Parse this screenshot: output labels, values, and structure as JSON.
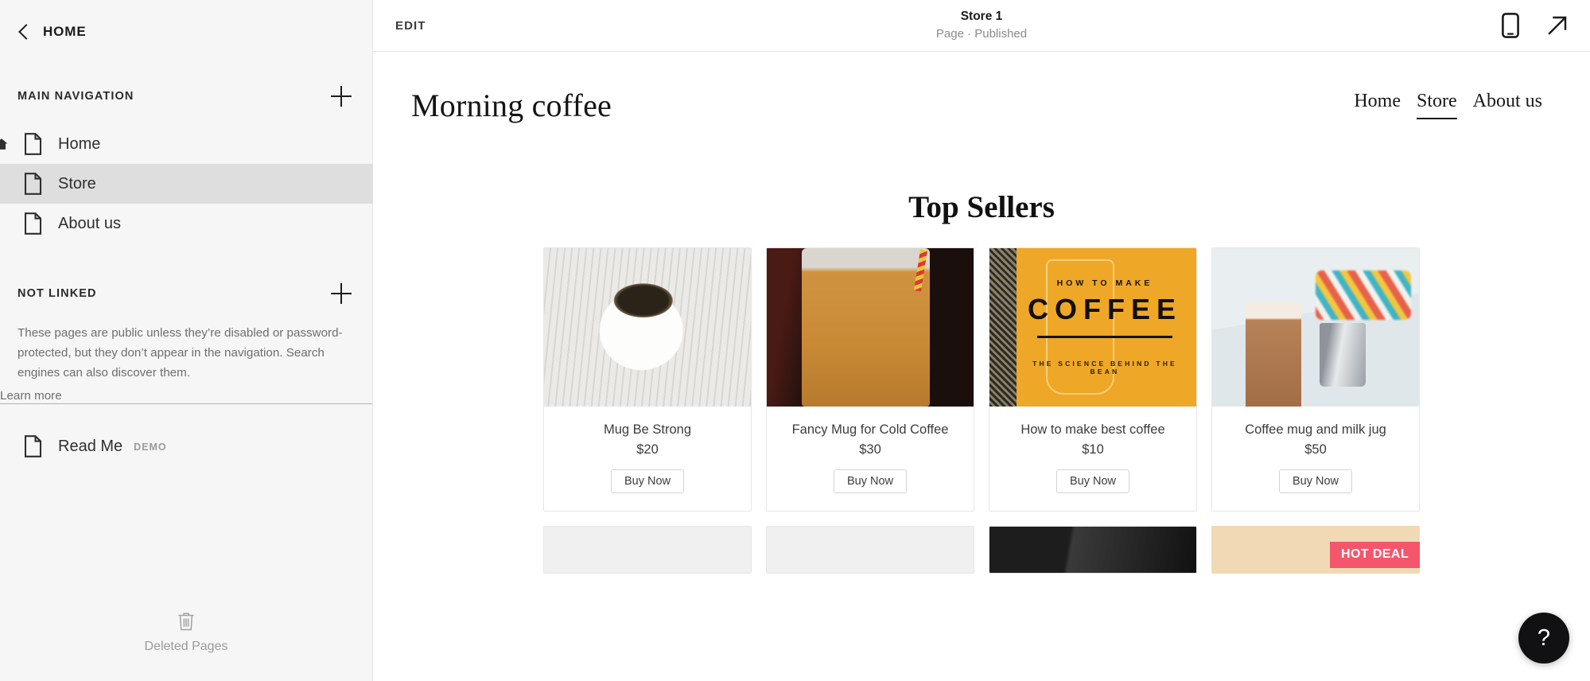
{
  "sidebar": {
    "back_label": "HOME",
    "sections": [
      {
        "title": "MAIN NAVIGATION",
        "add_label": "+"
      },
      {
        "title": "NOT LINKED",
        "add_label": "+"
      }
    ],
    "main_nav_items": [
      {
        "label": "Home",
        "active": false,
        "is_homepage": true
      },
      {
        "label": "Store",
        "active": true,
        "is_homepage": false
      },
      {
        "label": "About us",
        "active": false,
        "is_homepage": false
      }
    ],
    "not_linked_description": "These pages are public unless they’re disabled or password-protected, but they don’t appear in the navigation. Search engines can also discover them.",
    "learn_more_label": "Learn more",
    "not_linked_items": [
      {
        "label": "Read Me",
        "badge": "DEMO"
      }
    ],
    "deleted_pages_label": "Deleted Pages",
    "deleted_pages_icon": "trash-icon",
    "active_row_color": "#dedede",
    "background_color": "#f6f6f6"
  },
  "topbar": {
    "edit_label": "EDIT",
    "page_title": "Store 1",
    "page_status": "Page · Published",
    "icons": [
      {
        "name": "mobile-preview-icon"
      },
      {
        "name": "open-external-arrow-icon"
      }
    ]
  },
  "site": {
    "logo": "Morning coffee",
    "nav": [
      {
        "label": "Home",
        "current": false
      },
      {
        "label": "Store",
        "current": true
      },
      {
        "label": "About us",
        "current": false
      }
    ],
    "section_title": "Top Sellers",
    "buy_label": "Buy Now",
    "products": [
      {
        "name": "Mug Be Strong",
        "price": "$20",
        "image": "img-mugstrong",
        "image_alt": "white mug with BE STRONG text"
      },
      {
        "name": "Fancy Mug for Cold Coffee",
        "price": "$30",
        "image": "img-coldbrew",
        "image_alt": "mason jar of iced coffee with striped straw"
      },
      {
        "name": "How to make best coffee",
        "price": "$10",
        "image": "img-howto",
        "image_alt": "yellow poster How To Make Coffee"
      },
      {
        "name": "Coffee mug and milk jug",
        "price": "$50",
        "image": "img-latte",
        "image_alt": "latte glass beside steel milk jug"
      }
    ],
    "poster_text": {
      "line1": "HOW TO MAKE",
      "line2": "COFFEE",
      "line3": "THE SCIENCE BEHIND THE BEAN"
    },
    "second_row": [
      {
        "image": "img-plain"
      },
      {
        "image": "img-plain"
      },
      {
        "image": "img-dark"
      },
      {
        "image": "img-tan",
        "badge": "HOT DEAL",
        "badge_color": "#f4566b"
      }
    ]
  },
  "help": {
    "label": "?"
  }
}
